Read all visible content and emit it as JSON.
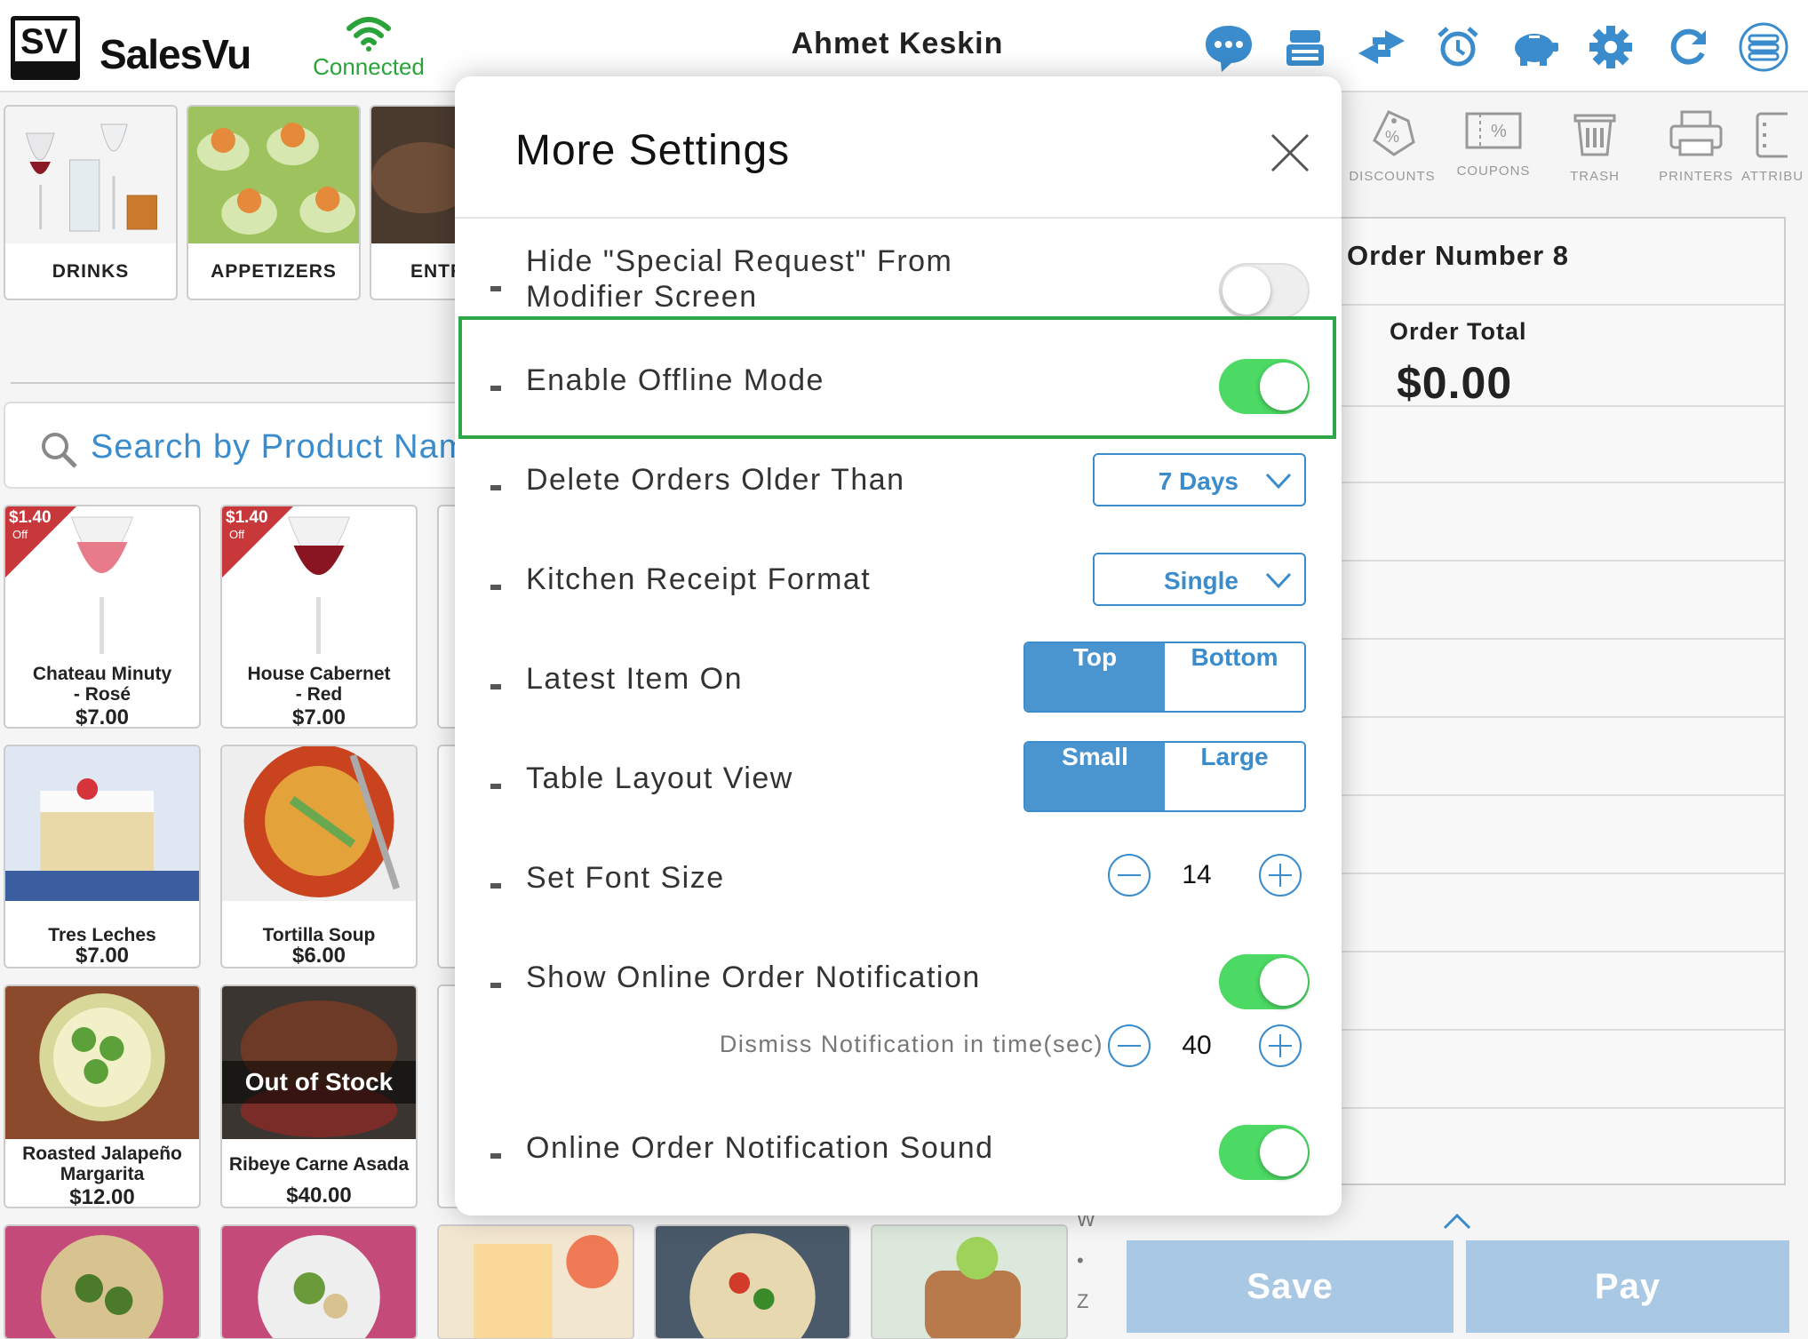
{
  "header": {
    "brand": "SalesVu",
    "logo_text": "SV",
    "connection_status": "Connected",
    "user_name": "Ahmet Keskin",
    "icons": [
      "chat-icon",
      "register-icon",
      "transfer-icon",
      "alarm-icon",
      "piggy-bank-icon",
      "gear-icon",
      "refresh-icon",
      "menu-list-icon"
    ]
  },
  "categories": [
    {
      "label": "DRINKS"
    },
    {
      "label": "APPETIZERS"
    },
    {
      "label": "ENTR"
    }
  ],
  "search": {
    "placeholder": "Search by Product Name"
  },
  "products": [
    {
      "name_line1": "Chateau Minuty",
      "name_line2": "- Rosé",
      "price": "$7.00",
      "discount": "$1.40",
      "discount_sub": "Off"
    },
    {
      "name_line1": "House Cabernet",
      "name_line2": "- Red",
      "price": "$7.00",
      "discount": "$1.40",
      "discount_sub": "Off"
    },
    {
      "name_line1": "Tres Leches",
      "name_line2": "",
      "price": "$7.00"
    },
    {
      "name_line1": "Tortilla Soup",
      "name_line2": "",
      "price": "$6.00"
    },
    {
      "name_line1": "Roasted Jalapeño",
      "name_line2": "Margarita",
      "price": "$12.00"
    },
    {
      "name_line1": "Ribeye Carne Asada",
      "name_line2": "",
      "price": "$40.00",
      "badge": "Out of Stock"
    }
  ],
  "tools": [
    {
      "label": "DISCOUNTS",
      "icon": "discount-tag-icon"
    },
    {
      "label": "COUPONS",
      "icon": "coupon-icon"
    },
    {
      "label": "TRASH",
      "icon": "trash-icon"
    },
    {
      "label": "PRINTERS",
      "icon": "printer-icon"
    },
    {
      "label": "ATTRIBU",
      "icon": "attributes-icon"
    }
  ],
  "order": {
    "number_label": "Order Number 8",
    "total_label": "Order Total",
    "total_value": "$0.00",
    "save_label": "Save",
    "pay_label": "Pay"
  },
  "alpha_index": [
    "W",
    "•",
    "Z"
  ],
  "modal": {
    "title": "More Settings",
    "settings": {
      "hide_special_line1": "Hide \"Special Request\" From",
      "hide_special_line2": "Modifier Screen",
      "hide_special_on": false,
      "offline_label": "Enable Offline Mode",
      "offline_on": true,
      "delete_orders_label": "Delete Orders Older Than",
      "delete_orders_value": "7 Days",
      "kitchen_receipt_label": "Kitchen Receipt Format",
      "kitchen_receipt_value": "Single",
      "latest_item_label": "Latest Item On",
      "latest_item_options": [
        "Top",
        "Bottom"
      ],
      "latest_item_selected": "Top",
      "table_layout_label": "Table Layout View",
      "table_layout_options": [
        "Small",
        "Large"
      ],
      "table_layout_selected": "Small",
      "font_size_label": "Set Font Size",
      "font_size_value": "14",
      "online_notif_label": "Show Online Order Notification",
      "online_notif_on": true,
      "dismiss_label": "Dismiss Notification in time(sec)",
      "dismiss_value": "40",
      "notif_sound_label": "Online Order Notification Sound",
      "notif_sound_on": true
    }
  },
  "colors": {
    "accent": "#3a8ccc",
    "toggle_on": "#4cd964",
    "highlight": "#2fa64a",
    "discount_corner": "#c8383b",
    "button_disabled": "#a9c8e4"
  }
}
